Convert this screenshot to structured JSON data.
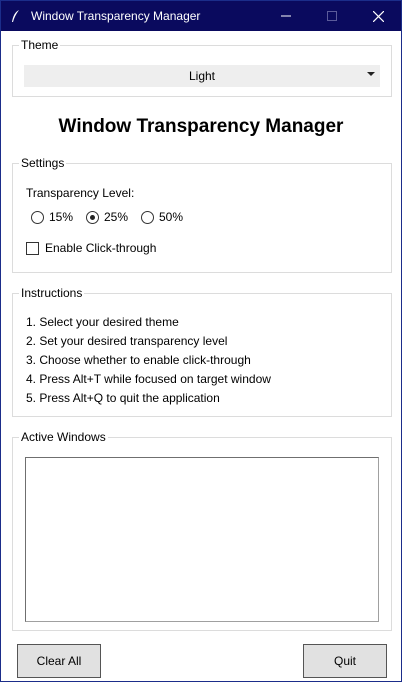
{
  "window": {
    "title": "Window Transparency Manager",
    "title_bar_color": "#0a0a5e"
  },
  "theme": {
    "legend": "Theme",
    "selected": "Light"
  },
  "heading": "Window Transparency Manager",
  "settings": {
    "legend": "Settings",
    "transparency_label": "Transparency Level:",
    "options": [
      "15%",
      "25%",
      "50%"
    ],
    "selected_option": "25%",
    "click_through_label": "Enable Click-through",
    "click_through_checked": false
  },
  "instructions": {
    "legend": "Instructions",
    "lines": [
      "1. Select your desired theme",
      "2. Set your desired transparency level",
      "3. Choose whether to enable click-through",
      "4. Press Alt+T while focused on target window",
      "5. Press Alt+Q to quit the application"
    ]
  },
  "active_windows": {
    "legend": "Active Windows",
    "items": []
  },
  "buttons": {
    "clear_all": "Clear All",
    "quit": "Quit"
  }
}
